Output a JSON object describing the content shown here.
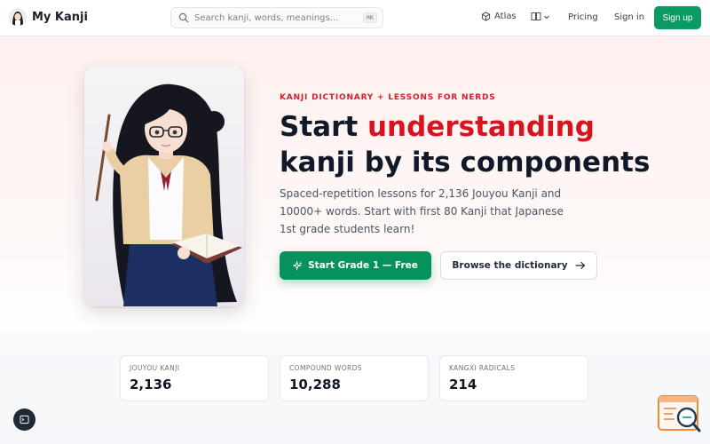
{
  "header": {
    "logo_text": "My Kanji",
    "search_placeholder": "Search kanji, words, meanings...",
    "search_shortcut": "⌘K",
    "nav": {
      "atlas": "Atlas",
      "pricing": "Pricing",
      "signin": "Sign in",
      "signup": "Sign up"
    }
  },
  "hero": {
    "eyebrow": "KANJI DICTIONARY + LESSONS FOR NERDS",
    "headline_part1": "Start ",
    "headline_accent": "understanding",
    "headline_part2": "kanji by its components",
    "subtext": "Spaced-repetition lessons for 2,136 Jouyou Kanji and 10000+ words. Start with first 80 Kanji that Japanese 1st grade students learn!",
    "cta_primary": "Start Grade 1 — Free",
    "cta_secondary": "Browse the dictionary"
  },
  "stats": [
    {
      "label": "JOUYOU KANJI",
      "value": "2,136"
    },
    {
      "label": "COMPOUND WORDS",
      "value": "10,288"
    },
    {
      "label": "KANGXI RADICALS",
      "value": "214"
    }
  ],
  "colors": {
    "brand_green": "#0a9b63",
    "accent_red": "#d7131f"
  },
  "icons": {
    "atlas": "cube-icon",
    "language": "book-open-icon",
    "cta_primary": "sparkles-icon",
    "cta_secondary": "arrow-right-icon"
  }
}
